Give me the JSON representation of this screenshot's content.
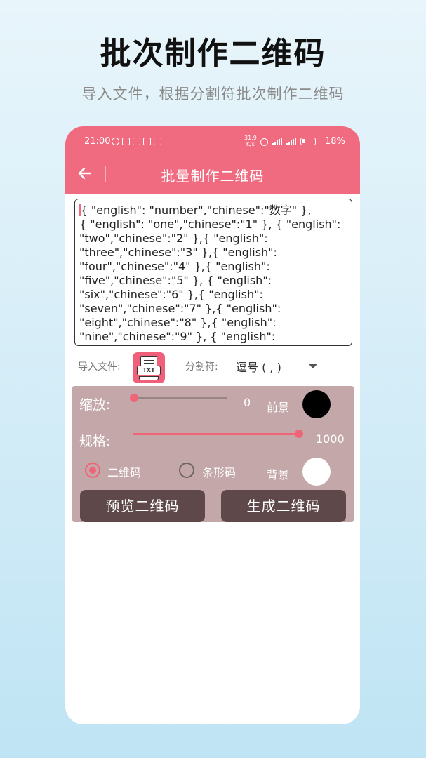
{
  "promo": {
    "title": "批次制作二维码",
    "subtitle": "导入文件，根据分割符批次制作二维码"
  },
  "status_bar": {
    "time": "21:00",
    "net_speed_value": "31.9",
    "net_speed_unit": "K/s",
    "network_labels": [
      "3G",
      "4G"
    ],
    "battery_percent": "18%"
  },
  "app_bar": {
    "title": "批量制作二维码",
    "back_icon": "arrow-left-icon"
  },
  "editor": {
    "content": "{ \"english\": \"number\",\"chinese\":\"数字\" },\n{ \"english\": \"one\",\"chinese\":\"1\" }, { \"english\":\n\"two\",\"chinese\":\"2\" },{ \"english\":\n\"three\",\"chinese\":\"3\" },{ \"english\":\n\"four\",\"chinese\":\"4\" },{ \"english\":\n\"five\",\"chinese\":\"5\" }, { \"english\":\n\"six\",\"chinese\":\"6\" },{ \"english\":\n\"seven\",\"chinese\":\"7\" },{ \"english\":\n\"eight\",\"chinese\":\"8\" },{ \"english\":\n\"nine\",\"chinese\":\"9\" }, { \"english\":"
  },
  "import_row": {
    "import_label": "导入文件:",
    "txt_icon_label": "TXT",
    "separator_label": "分割符:",
    "separator_value": "逗号 ( , )"
  },
  "settings": {
    "zoom_label": "缩放:",
    "zoom_value": "0",
    "zoom_fraction": 0.0,
    "foreground_label": "前景",
    "foreground_color": "#000000",
    "size_label": "规格:",
    "size_value": "1000",
    "size_fraction": 1.0,
    "background_label": "背景",
    "background_color": "#ffffff",
    "type_options": [
      {
        "label": "二维码",
        "selected": true
      },
      {
        "label": "条形码",
        "selected": false
      }
    ],
    "preview_button": "预览二维码",
    "generate_button": "生成二维码"
  },
  "colors": {
    "accent": "#f06a80",
    "panel": "#c4a7a8",
    "button": "#5e4849"
  }
}
